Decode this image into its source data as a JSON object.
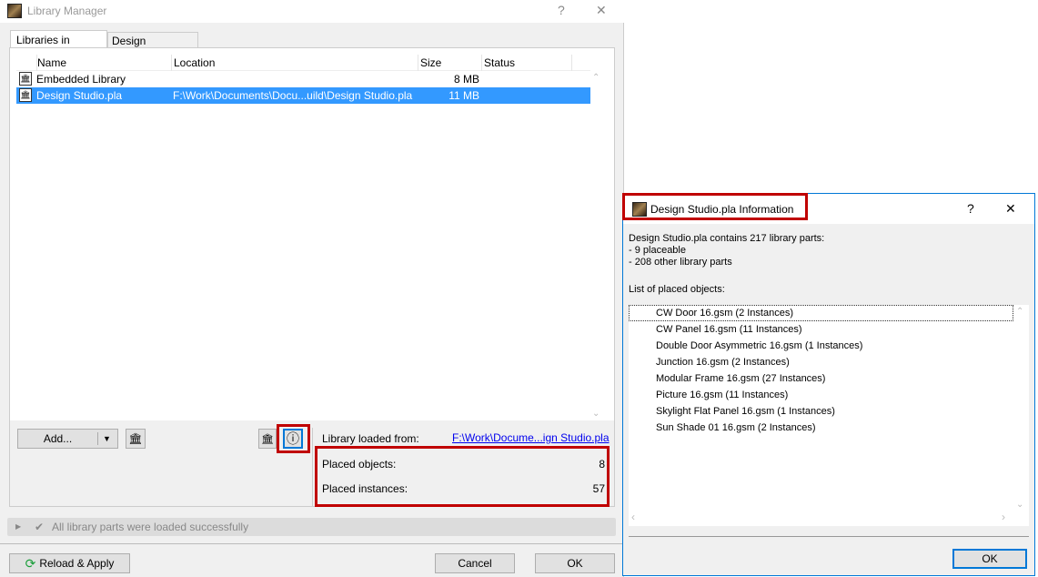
{
  "main": {
    "title": "Library Manager",
    "help": "?",
    "close": "✕",
    "tabs": [
      {
        "label": "Libraries in Project"
      },
      {
        "label": "Design Studio.pla"
      }
    ],
    "columns": [
      "Name",
      "Location",
      "Size",
      "Status"
    ],
    "rows": [
      {
        "name": "Embedded Library",
        "location": "",
        "size": "8 MB",
        "status": "",
        "selected": false
      },
      {
        "name": "Design Studio.pla",
        "location": "F:\\Work\\Documents\\Docu...uild\\Design Studio.pla",
        "size": "11 MB",
        "status": "",
        "selected": true
      }
    ],
    "add_label": "Add...",
    "loaded_from_label": "Library loaded from:",
    "loaded_from_link": "F:\\Work\\Docume...ign Studio.pla",
    "placed_objects_label": "Placed objects:",
    "placed_objects": "8",
    "placed_instances_label": "Placed instances:",
    "placed_instances": "57",
    "status_message": "All library parts were loaded successfully",
    "reload_label": "Reload & Apply",
    "cancel_label": "Cancel",
    "ok_label": "OK"
  },
  "info": {
    "title": "Design Studio.pla Information",
    "help": "?",
    "close": "✕",
    "summary": [
      "Design Studio.pla contains 217 library parts:",
      "- 9 placeable",
      "- 208 other library parts"
    ],
    "list_label": "List of placed objects:",
    "items": [
      "CW Door 16.gsm (2 Instances)",
      "CW Panel 16.gsm (11 Instances)",
      "Double Door Asymmetric 16.gsm (1 Instances)",
      "Junction 16.gsm (2 Instances)",
      "Modular Frame 16.gsm (27 Instances)",
      "Picture 16.gsm (11 Instances)",
      "Skylight Flat Panel 16.gsm (1 Instances)",
      "Sun Shade 01 16.gsm (2 Instances)"
    ],
    "ok_label": "OK"
  },
  "colors": {
    "selection": "#3399ff",
    "highlight": "#c00000",
    "accent": "#0078d7",
    "link": "#0000ee"
  }
}
